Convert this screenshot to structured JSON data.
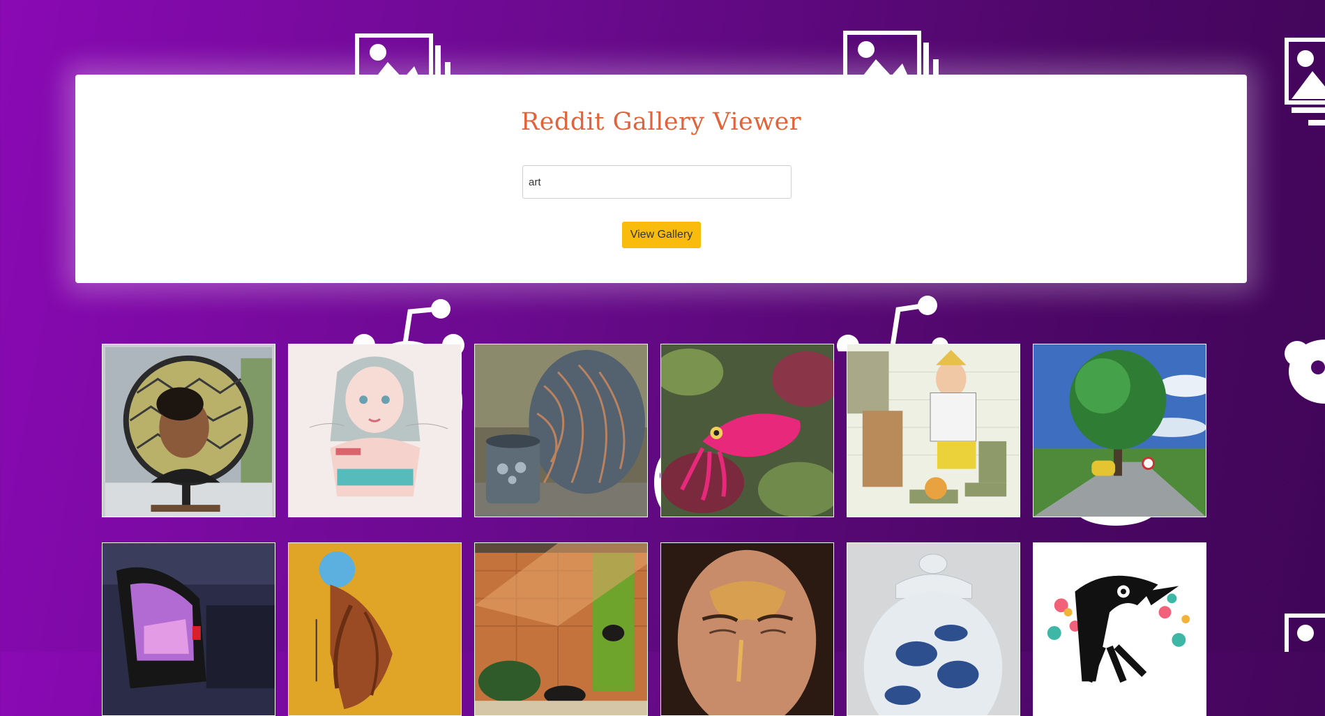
{
  "app": {
    "title": "Reddit Gallery Viewer",
    "title_color": "#e2623a"
  },
  "search": {
    "value": "art",
    "placeholder": ""
  },
  "actions": {
    "view_gallery_label": "View Gallery",
    "button_color": "#f9bb0c"
  },
  "theme": {
    "background_start": "#8a09b4",
    "background_end": "#3f0557"
  },
  "background_icons": [
    "image-icon",
    "reddit-alien-icon"
  ],
  "gallery": {
    "columns": 6,
    "items": [
      {
        "alt": "portrait-in-stained-glass-mirror"
      },
      {
        "alt": "pastel-girl-illustration"
      },
      {
        "alt": "patterned-ceramic-vase"
      },
      {
        "alt": "pink-cuttlefish-on-leaves"
      },
      {
        "alt": "man-with-money-sketch"
      },
      {
        "alt": "green-tree-landscape"
      },
      {
        "alt": "car-mirror-night"
      },
      {
        "alt": "blue-headed-figure-painting"
      },
      {
        "alt": "cat-on-windowsill-illustration"
      },
      {
        "alt": "honey-on-face"
      },
      {
        "alt": "blue-white-porcelain-jar"
      },
      {
        "alt": "black-crow-colorful-print"
      }
    ]
  }
}
